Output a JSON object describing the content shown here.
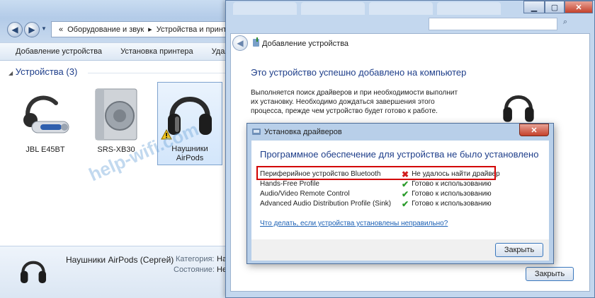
{
  "explorer": {
    "breadcrumb": [
      "«",
      "Оборудование и звук",
      "Устройства и принтеры"
    ],
    "toolbar": [
      "Добавление устройства",
      "Установка принтера",
      "Удалить устройство"
    ],
    "group_title": "Устройства (3)",
    "devices": [
      {
        "label": "JBL E45BT",
        "icon": "bluetooth-headset-icon"
      },
      {
        "label": "SRS-XB30",
        "icon": "speaker-icon"
      },
      {
        "label": "Наушники AirPods",
        "icon": "headphones-icon",
        "warning": true
      }
    ],
    "details": {
      "name": "Наушники AirPods (Сергей)",
      "category_label": "Категория:",
      "category_value": "Наушники",
      "state_label": "Состояние:",
      "state_value": "Не подключено"
    }
  },
  "add_device": {
    "title": "Добавление устройства",
    "heading": "Это устройство успешно добавлено на компьютер",
    "description": "Выполняется поиск драйверов и при необходимости выполнит их установку. Необходимо дождаться завершения этого процесса, прежде чем устройство будет готово к работе.",
    "close_button": "Закрыть"
  },
  "driver_install": {
    "title": "Установка драйверов",
    "heading": "Программное обеспечение для устройства не было установлено",
    "rows": [
      {
        "name": "Периферийное устройство Bluetooth",
        "status": "Не удалось найти драйвер",
        "ok": false
      },
      {
        "name": "Hands-Free Profile",
        "status": "Готово к использованию",
        "ok": true
      },
      {
        "name": "Audio/Video Remote Control",
        "status": "Готово к использованию",
        "ok": true
      },
      {
        "name": "Advanced Audio Distribution Profile (Sink)",
        "status": "Готово к использованию",
        "ok": true
      }
    ],
    "link": "Что делать, если устройства установлены неправильно?",
    "close_button": "Закрыть"
  },
  "watermark": "help-wifi.com",
  "colors": {
    "heading": "#1e3e8a",
    "error": "#d21e1e",
    "ok": "#2c9c2c",
    "highlight_box": "#d20000"
  }
}
